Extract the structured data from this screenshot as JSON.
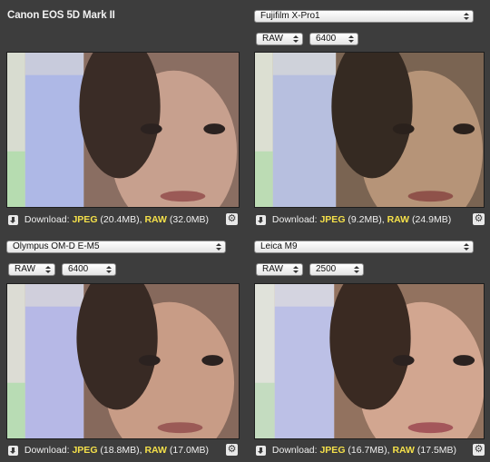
{
  "panels": [
    {
      "camera": "Canon EOS 5D Mark II",
      "camera_is_select": false,
      "format": null,
      "iso": null,
      "download_label": "Download:",
      "jpeg_label": "JPEG",
      "jpeg_size": "(20.4MB),",
      "raw_label": "RAW",
      "raw_size": "(32.0MB)",
      "tint": "#b89c8e"
    },
    {
      "camera": "Fujifilm X-Pro1",
      "camera_is_select": true,
      "format": "RAW",
      "iso": "6400",
      "download_label": "Download:",
      "jpeg_label": "JPEG",
      "jpeg_size": "(9.2MB),",
      "raw_label": "RAW",
      "raw_size": "(24.9MB)",
      "tint": "#a58a70"
    },
    {
      "camera": "Olympus OM-D E-M5",
      "camera_is_select": true,
      "format": "RAW",
      "iso": "6400",
      "download_label": "Download:",
      "jpeg_label": "JPEG",
      "jpeg_size": "(18.8MB),",
      "raw_label": "RAW",
      "raw_size": "(17.0MB)",
      "tint": "#b8907c"
    },
    {
      "camera": "Leica M9",
      "camera_is_select": true,
      "format": "RAW",
      "iso": "2500",
      "download_label": "Download:",
      "jpeg_label": "JPEG",
      "jpeg_size": "(16.7MB),",
      "raw_label": "RAW",
      "raw_size": "(17.5MB)",
      "tint": "#c49a88"
    }
  ],
  "icons": {
    "download": "download-icon",
    "settings": "gear-icon"
  },
  "colors": {
    "background": "#3d3d3d",
    "link": "#f4e04a"
  }
}
